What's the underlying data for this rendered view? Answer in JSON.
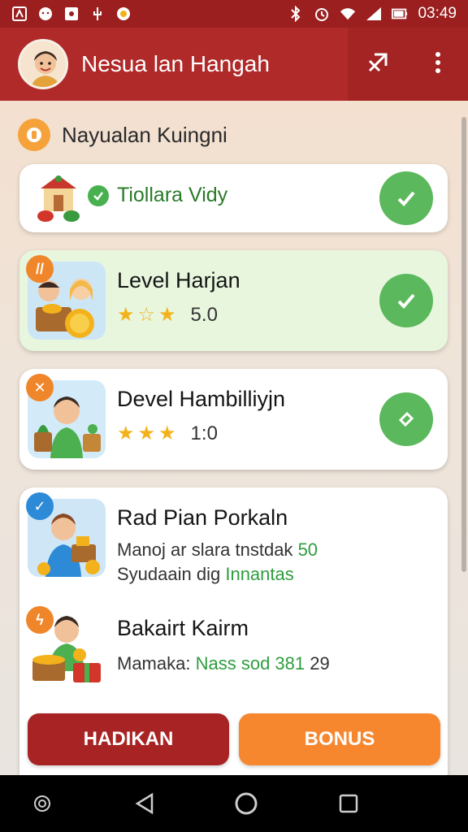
{
  "status_bar": {
    "time": "03:49",
    "icons": [
      "app-icon",
      "face-icon",
      "image-icon",
      "usb-icon",
      "record-icon",
      "bluetooth-icon",
      "alarm-icon",
      "wifi-icon",
      "signal-icon",
      "battery-icon"
    ]
  },
  "app_bar": {
    "title": "Nesua lan Hangah",
    "actions": [
      "share-icon",
      "more-vert-icon"
    ]
  },
  "section": {
    "title": "Nayualan Kuingni"
  },
  "cards": [
    {
      "title": "Tiollara Vidy"
    },
    {
      "title": "Level Harjan",
      "stars": 3,
      "rating": "5.0"
    },
    {
      "title": "Devel Hambilliyjn",
      "stars": 3,
      "rating": "1:0"
    }
  ],
  "tasks": [
    {
      "title": "Rad Pian Porkaln",
      "line1": "Manoj ar slara tnstdak",
      "line1_value": "50",
      "line2_prefix": "Syudaain dig",
      "line2_green": "Innantas"
    },
    {
      "title": "Bakairt Kairm",
      "line1": "Mamaka:",
      "line1_green": "Nass sod 381",
      "line1_value": "29"
    }
  ],
  "buttons": {
    "primary": "HADIKAN",
    "secondary": "BONUS"
  },
  "colors": {
    "primary": "#b02a2a",
    "accent": "#f6872f",
    "success": "#5cb85c"
  }
}
